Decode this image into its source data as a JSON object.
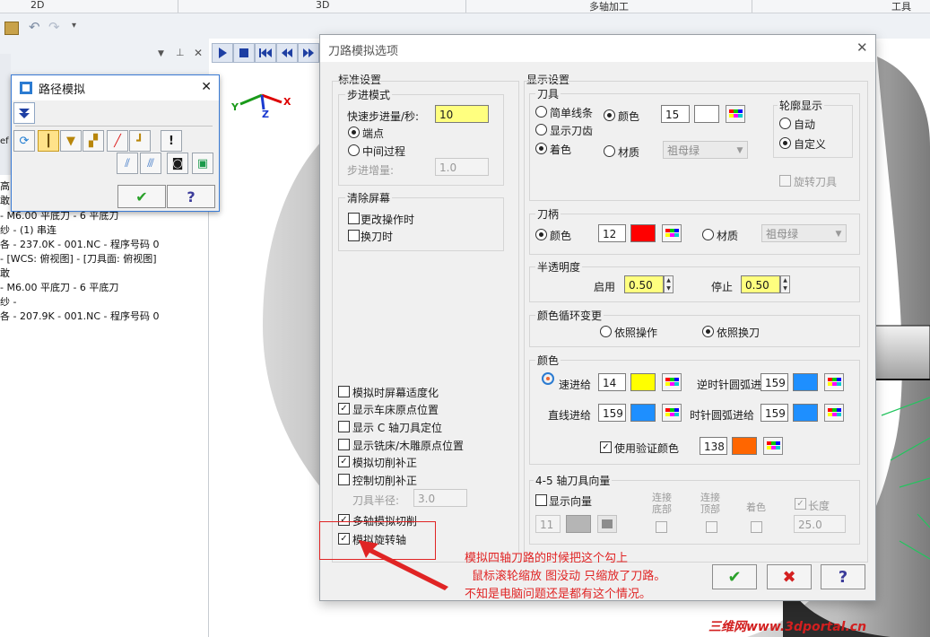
{
  "ribbon": {
    "tabs": [
      "2D",
      "3D",
      "多轴加工",
      "工具"
    ]
  },
  "tree": {
    "lines": [
      "高",
      "敢",
      "- M6.00 平底刀 - 6 平底刀",
      "纱 - (1) 串连",
      "各 - 237.0K - 001.NC - 程序号码 0",
      "- [WCS: 俯视图] - [刀具面: 俯视图]",
      "敢",
      "- M6.00 平底刀 - 6 平底刀",
      "纱 -",
      "各 - 207.9K - 001.NC - 程序号码 0"
    ],
    "side_fragment": "ef"
  },
  "sim_window": {
    "title": "路径模拟",
    "close": "✕",
    "ok": "✔",
    "help": "?"
  },
  "axes": {
    "x": "X",
    "y": "Y",
    "z": "Z"
  },
  "dialog": {
    "title": "刀路模拟选项",
    "close": "✕",
    "standard": {
      "label": "标准设置",
      "step_mode": {
        "label": "步进模式",
        "fast_step_label": "快速步进量/秒:",
        "fast_step_value": "10",
        "opt_endpoint": "端点",
        "opt_midprocess": "中间过程",
        "step_inc_label": "步进增量:",
        "step_inc_value": "1.0"
      },
      "clear_screen": {
        "label": "清除屏幕",
        "on_op_change": "更改操作时",
        "on_tool_change": "换刀时"
      },
      "options": [
        {
          "label": "模拟时屏幕适度化",
          "checked": false
        },
        {
          "label": "显示车床原点位置",
          "checked": true
        },
        {
          "label": "显示 C 轴刀具定位",
          "checked": false
        },
        {
          "label": "显示铣床/木雕原点位置",
          "checked": false
        },
        {
          "label": "模拟切削补正",
          "checked": true
        },
        {
          "label": "控制切削补正",
          "checked": false
        }
      ],
      "tool_radius_label": "刀具半径:",
      "tool_radius_value": "3.0",
      "multi_axis": {
        "label": "多轴模拟切削",
        "checked": true
      },
      "rotary_axis": {
        "label": "模拟旋转轴",
        "checked": true
      }
    },
    "display": {
      "label": "显示设置",
      "tool": {
        "label": "刀具",
        "simple_lines": "简单线条",
        "show_edge": "显示刀齿",
        "shaded": "着色",
        "color_label": "颜色",
        "color_value": "15",
        "color_hex": "#ffffff",
        "material_label": "材质",
        "material_value": "祖母绿",
        "outline": {
          "label": "轮廓显示",
          "auto": "自动",
          "custom": "自定义"
        },
        "rotate_tool": "旋转刀具"
      },
      "holder": {
        "label": "刀柄",
        "color_label": "颜色",
        "color_value": "12",
        "color_hex": "#ff0000",
        "material_label": "材质",
        "material_value": "祖母绿"
      },
      "transparency": {
        "label": "半透明度",
        "enable_label": "启用",
        "enable_value": "0.50",
        "stop_label": "停止",
        "stop_value": "0.50"
      },
      "color_cycle": {
        "label": "颜色循环变更",
        "by_op": "依照操作",
        "by_tool": "依照换刀"
      },
      "colors": {
        "label": "颜色",
        "rapid_label": "速进给",
        "rapid_value": "14",
        "rapid_hex": "#ffff00",
        "line_label": "直线进给",
        "line_value": "159",
        "line_hex": "#1e8fff",
        "ccw_label": "逆时针圆弧进给",
        "ccw_value": "159",
        "ccw_hex": "#1e8fff",
        "cw_label": "时针圆弧进给",
        "cw_value": "159",
        "cw_hex": "#1e8fff",
        "verify_label": "使用验证颜色",
        "verify_value": "138",
        "verify_hex": "#ff6600"
      },
      "vector": {
        "label": "4-5 轴刀具向量",
        "show_vector": "显示向量",
        "connect_bottom": "连接\n底部",
        "connect_top": "连接\n顶部",
        "shade": "着色",
        "length_label": "长度",
        "vec_value": "11",
        "length_value": "25.0"
      }
    },
    "buttons": {
      "ok": "✔",
      "cancel": "✖",
      "help": "?"
    }
  },
  "annotation": {
    "line1": "模拟四轴刀路的时候把这个勾上",
    "line2": "鼠标滚轮缩放 图没动  只缩放了刀路。",
    "line3": "不知是电脑问题还是都有这个情况。",
    "color": "#e02424"
  },
  "watermark": "三维网www.3dportal.cn"
}
